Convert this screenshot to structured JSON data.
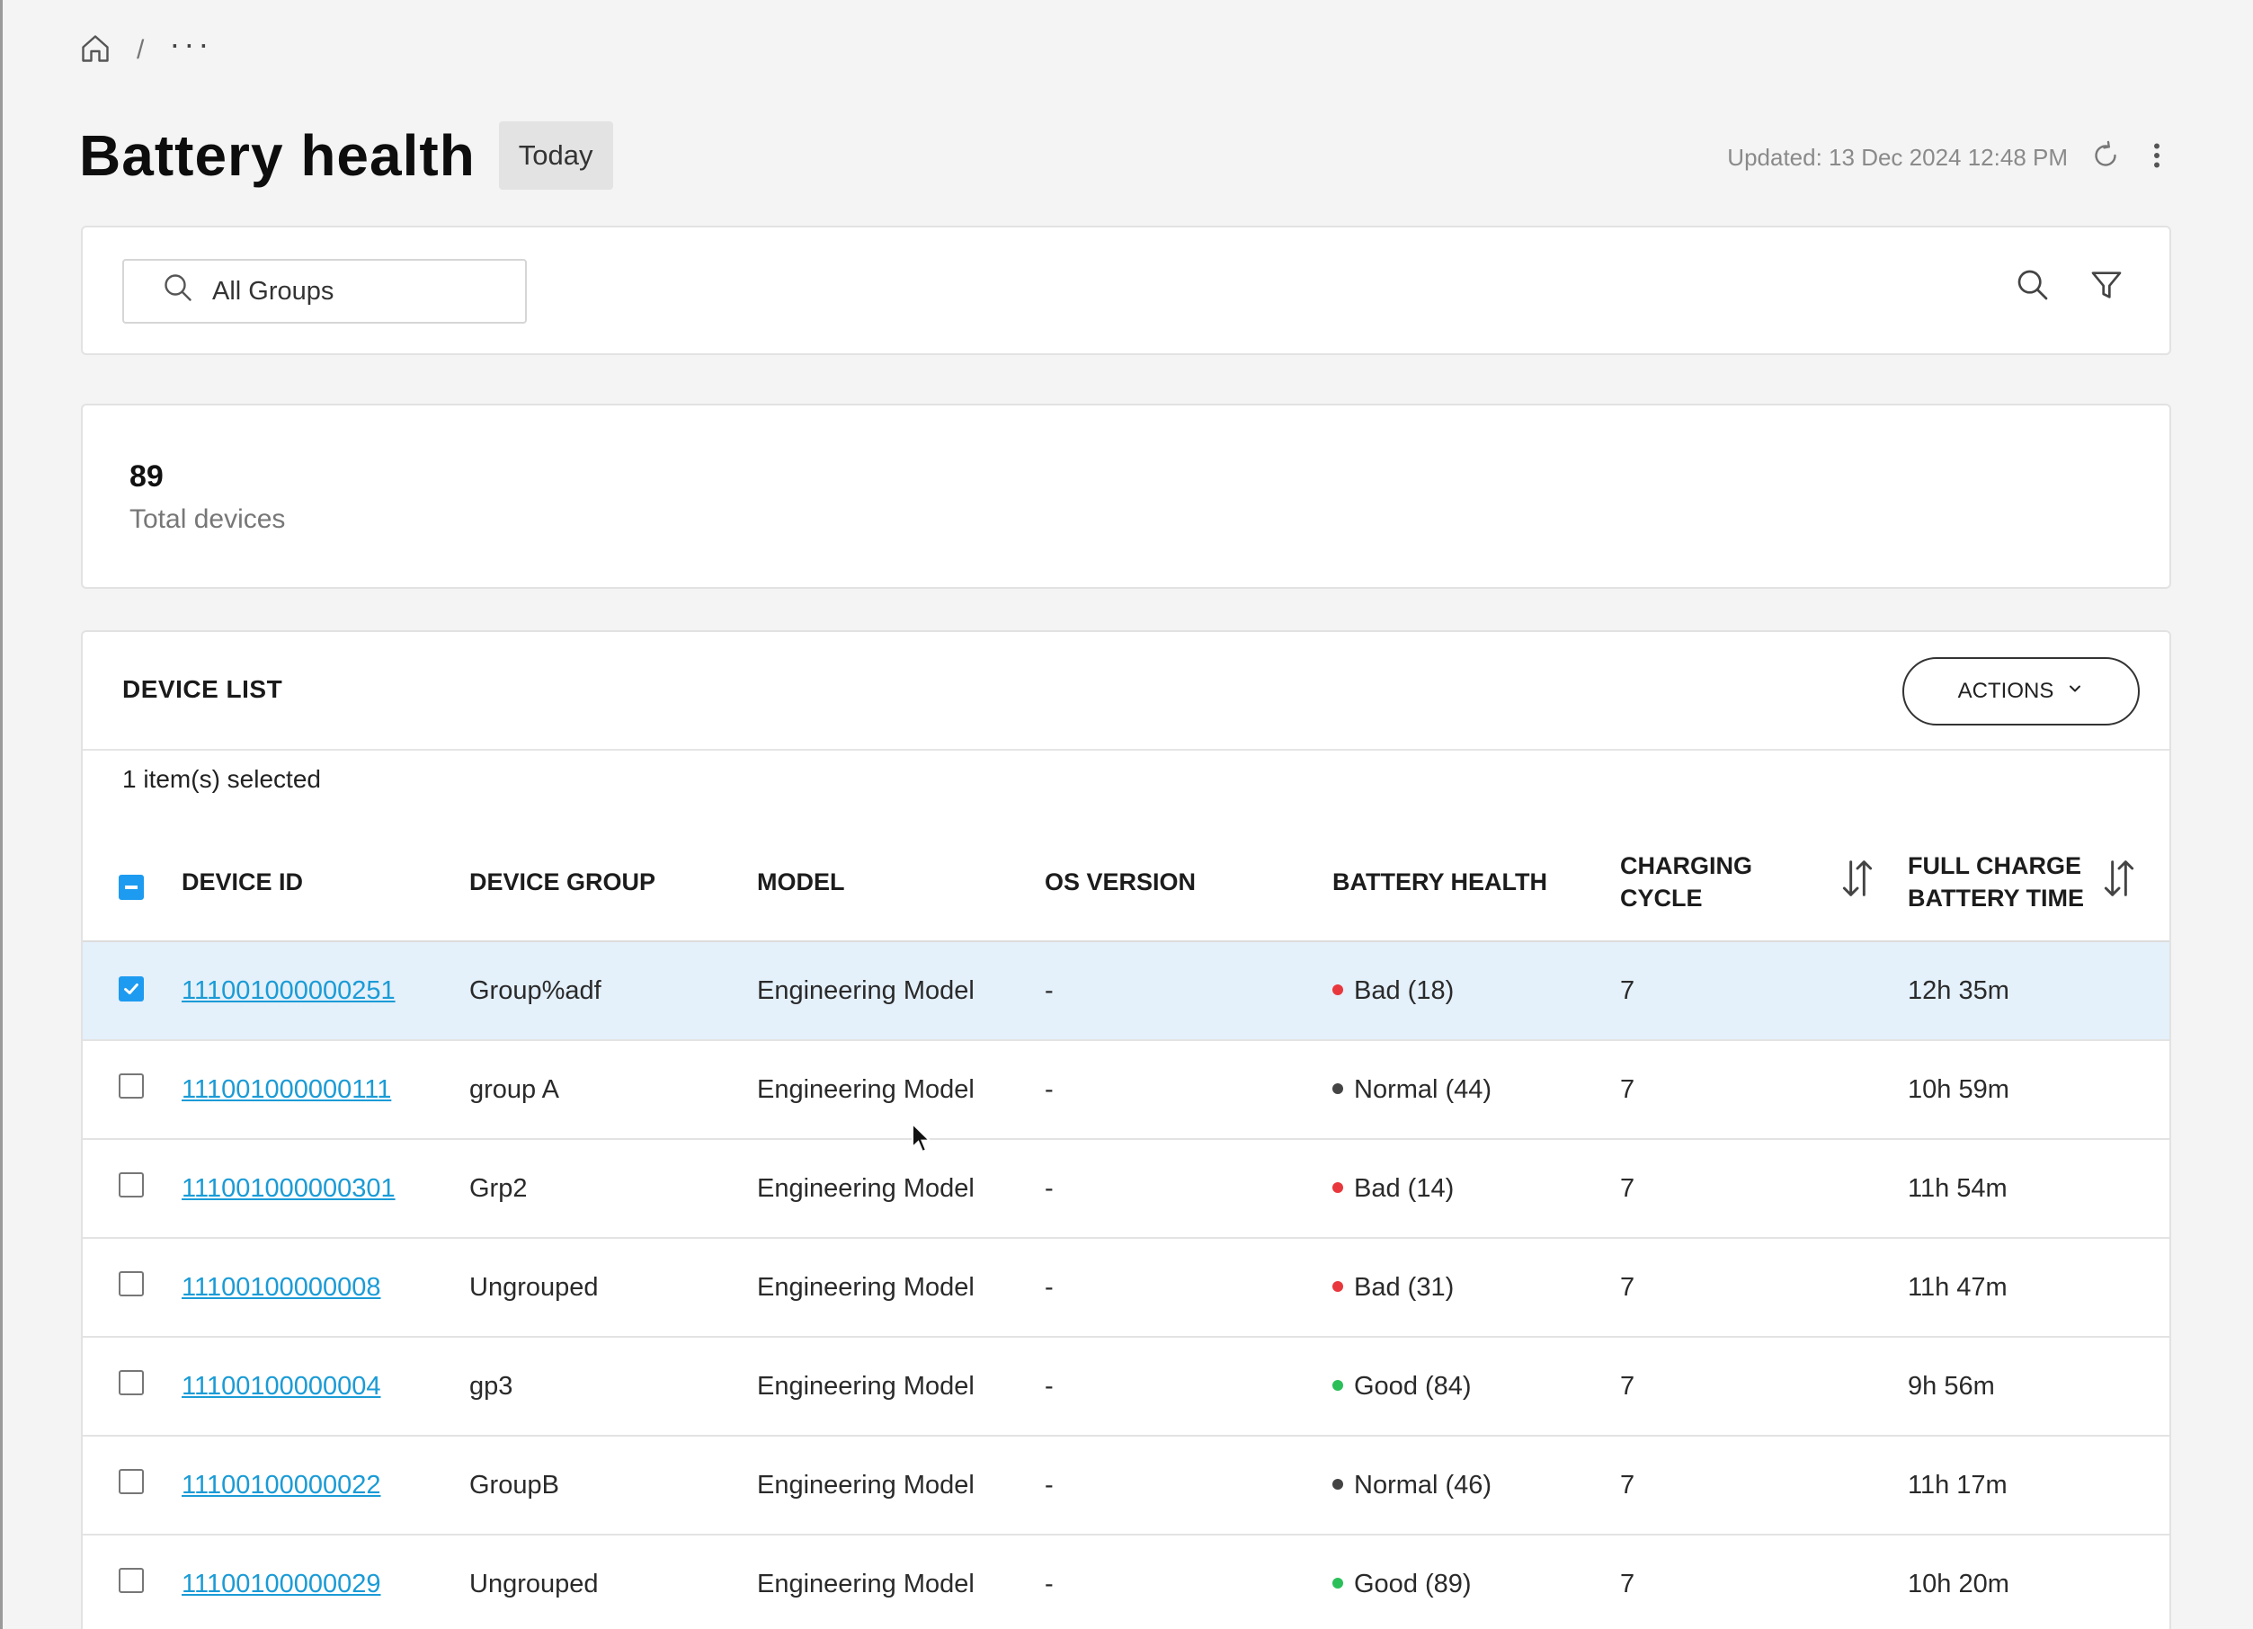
{
  "breadcrumb": {
    "separator": "/",
    "more": "···"
  },
  "header": {
    "title": "Battery health",
    "period_badge": "Today",
    "updated": "Updated: 13 Dec 2024 12:48 PM"
  },
  "filter": {
    "group_select": "All Groups"
  },
  "summary": {
    "total_count": "89",
    "total_label": "Total devices"
  },
  "device_list": {
    "title": "DEVICE LIST",
    "actions_label": "ACTIONS",
    "selected_info": "1 item(s) selected",
    "columns": {
      "device_id": "DEVICE ID",
      "device_group": "DEVICE GROUP",
      "model": "MODEL",
      "os_version": "OS VERSION",
      "battery_health": "BATTERY HEALTH",
      "charging_cycle": "CHARGING CYCLE",
      "full_charge": "FULL CHARGE BATTERY TIME"
    },
    "status_colors": {
      "Bad": "#e8383d",
      "Normal": "#444444",
      "Good": "#2bbf5a"
    },
    "rows": [
      {
        "checked": true,
        "id": "111001000000251",
        "group": "Group%adf",
        "model": "Engineering Model",
        "os": "-",
        "health_status": "Bad",
        "health": "Bad (18)",
        "cycle": "7",
        "full_charge": "12h 35m"
      },
      {
        "checked": false,
        "id": "111001000000111",
        "group": "group A",
        "model": "Engineering Model",
        "os": "-",
        "health_status": "Normal",
        "health": "Normal (44)",
        "cycle": "7",
        "full_charge": "10h 59m"
      },
      {
        "checked": false,
        "id": "111001000000301",
        "group": "Grp2",
        "model": "Engineering Model",
        "os": "-",
        "health_status": "Bad",
        "health": "Bad (14)",
        "cycle": "7",
        "full_charge": "11h 54m"
      },
      {
        "checked": false,
        "id": "11100100000008",
        "group": "Ungrouped",
        "model": "Engineering Model",
        "os": "-",
        "health_status": "Bad",
        "health": "Bad (31)",
        "cycle": "7",
        "full_charge": "11h 47m"
      },
      {
        "checked": false,
        "id": "11100100000004",
        "group": "gp3",
        "model": "Engineering Model",
        "os": "-",
        "health_status": "Good",
        "health": "Good (84)",
        "cycle": "7",
        "full_charge": "9h 56m"
      },
      {
        "checked": false,
        "id": "11100100000022",
        "group": "GroupB",
        "model": "Engineering Model",
        "os": "-",
        "health_status": "Normal",
        "health": "Normal (46)",
        "cycle": "7",
        "full_charge": "11h 17m"
      },
      {
        "checked": false,
        "id": "11100100000029",
        "group": "Ungrouped",
        "model": "Engineering Model",
        "os": "-",
        "health_status": "Good",
        "health": "Good (89)",
        "cycle": "7",
        "full_charge": "10h 20m"
      }
    ]
  }
}
